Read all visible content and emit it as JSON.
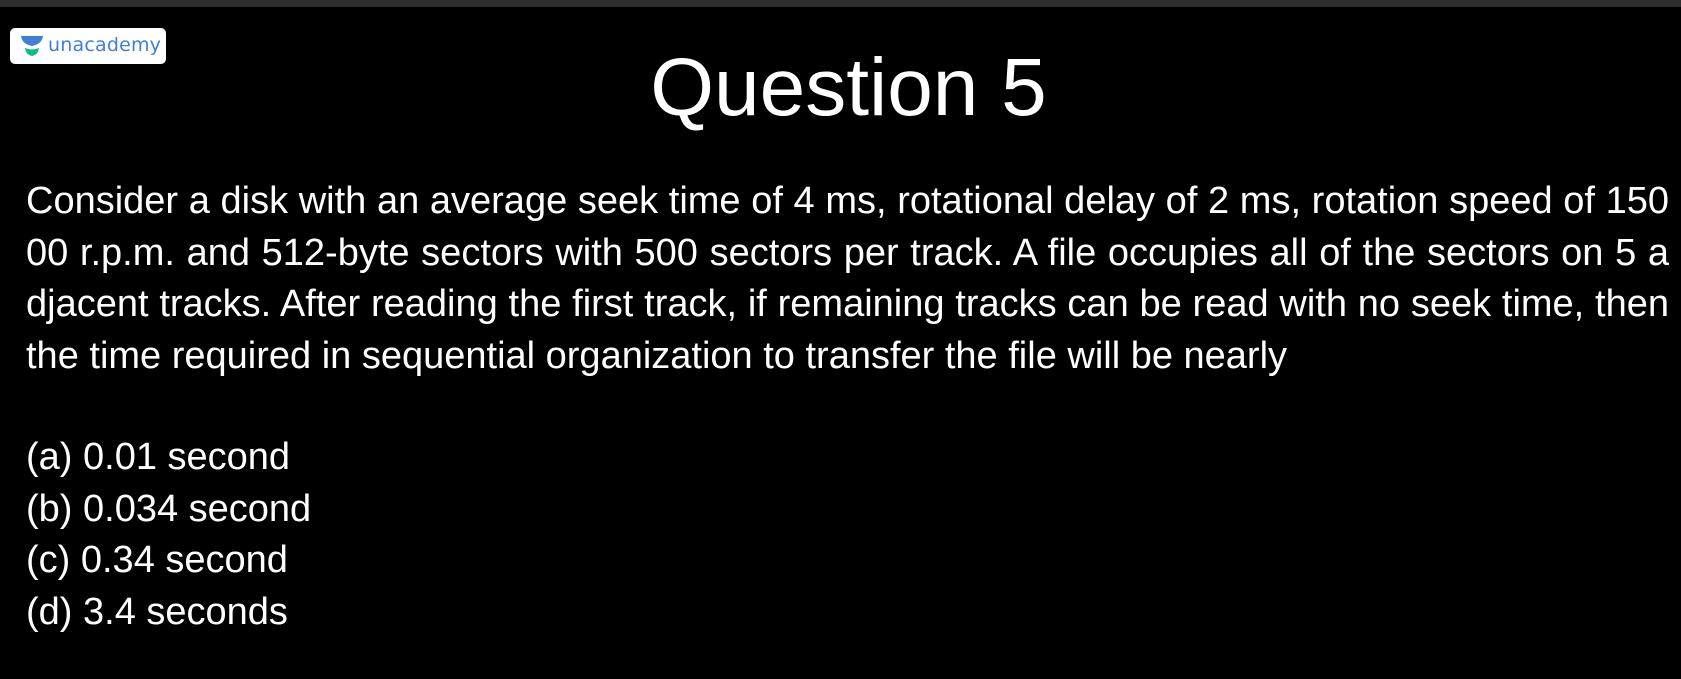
{
  "brand": {
    "name": "unacademy",
    "logo_icon": "unacademy-logo-icon",
    "accent_color": "#3f7fd6",
    "logo_mark_color": "#08bd80"
  },
  "slide": {
    "title": "Question 5",
    "question": "Consider a disk with an average seek time of 4 ms, rotational delay of 2 ms, rotation speed of 15000 r.p.m. and 512-byte sectors with 500 sectors per track. A file occupies all of the sectors on 5 adjacent tracks. After reading the first track, if remaining tracks can be read with no seek time, then the time required in sequential organization to transfer the file will be nearly",
    "options": [
      "(a) 0.01 second",
      "(b) 0.034 second",
      "(c) 0.34 second",
      "(d) 3.4 seconds"
    ]
  }
}
